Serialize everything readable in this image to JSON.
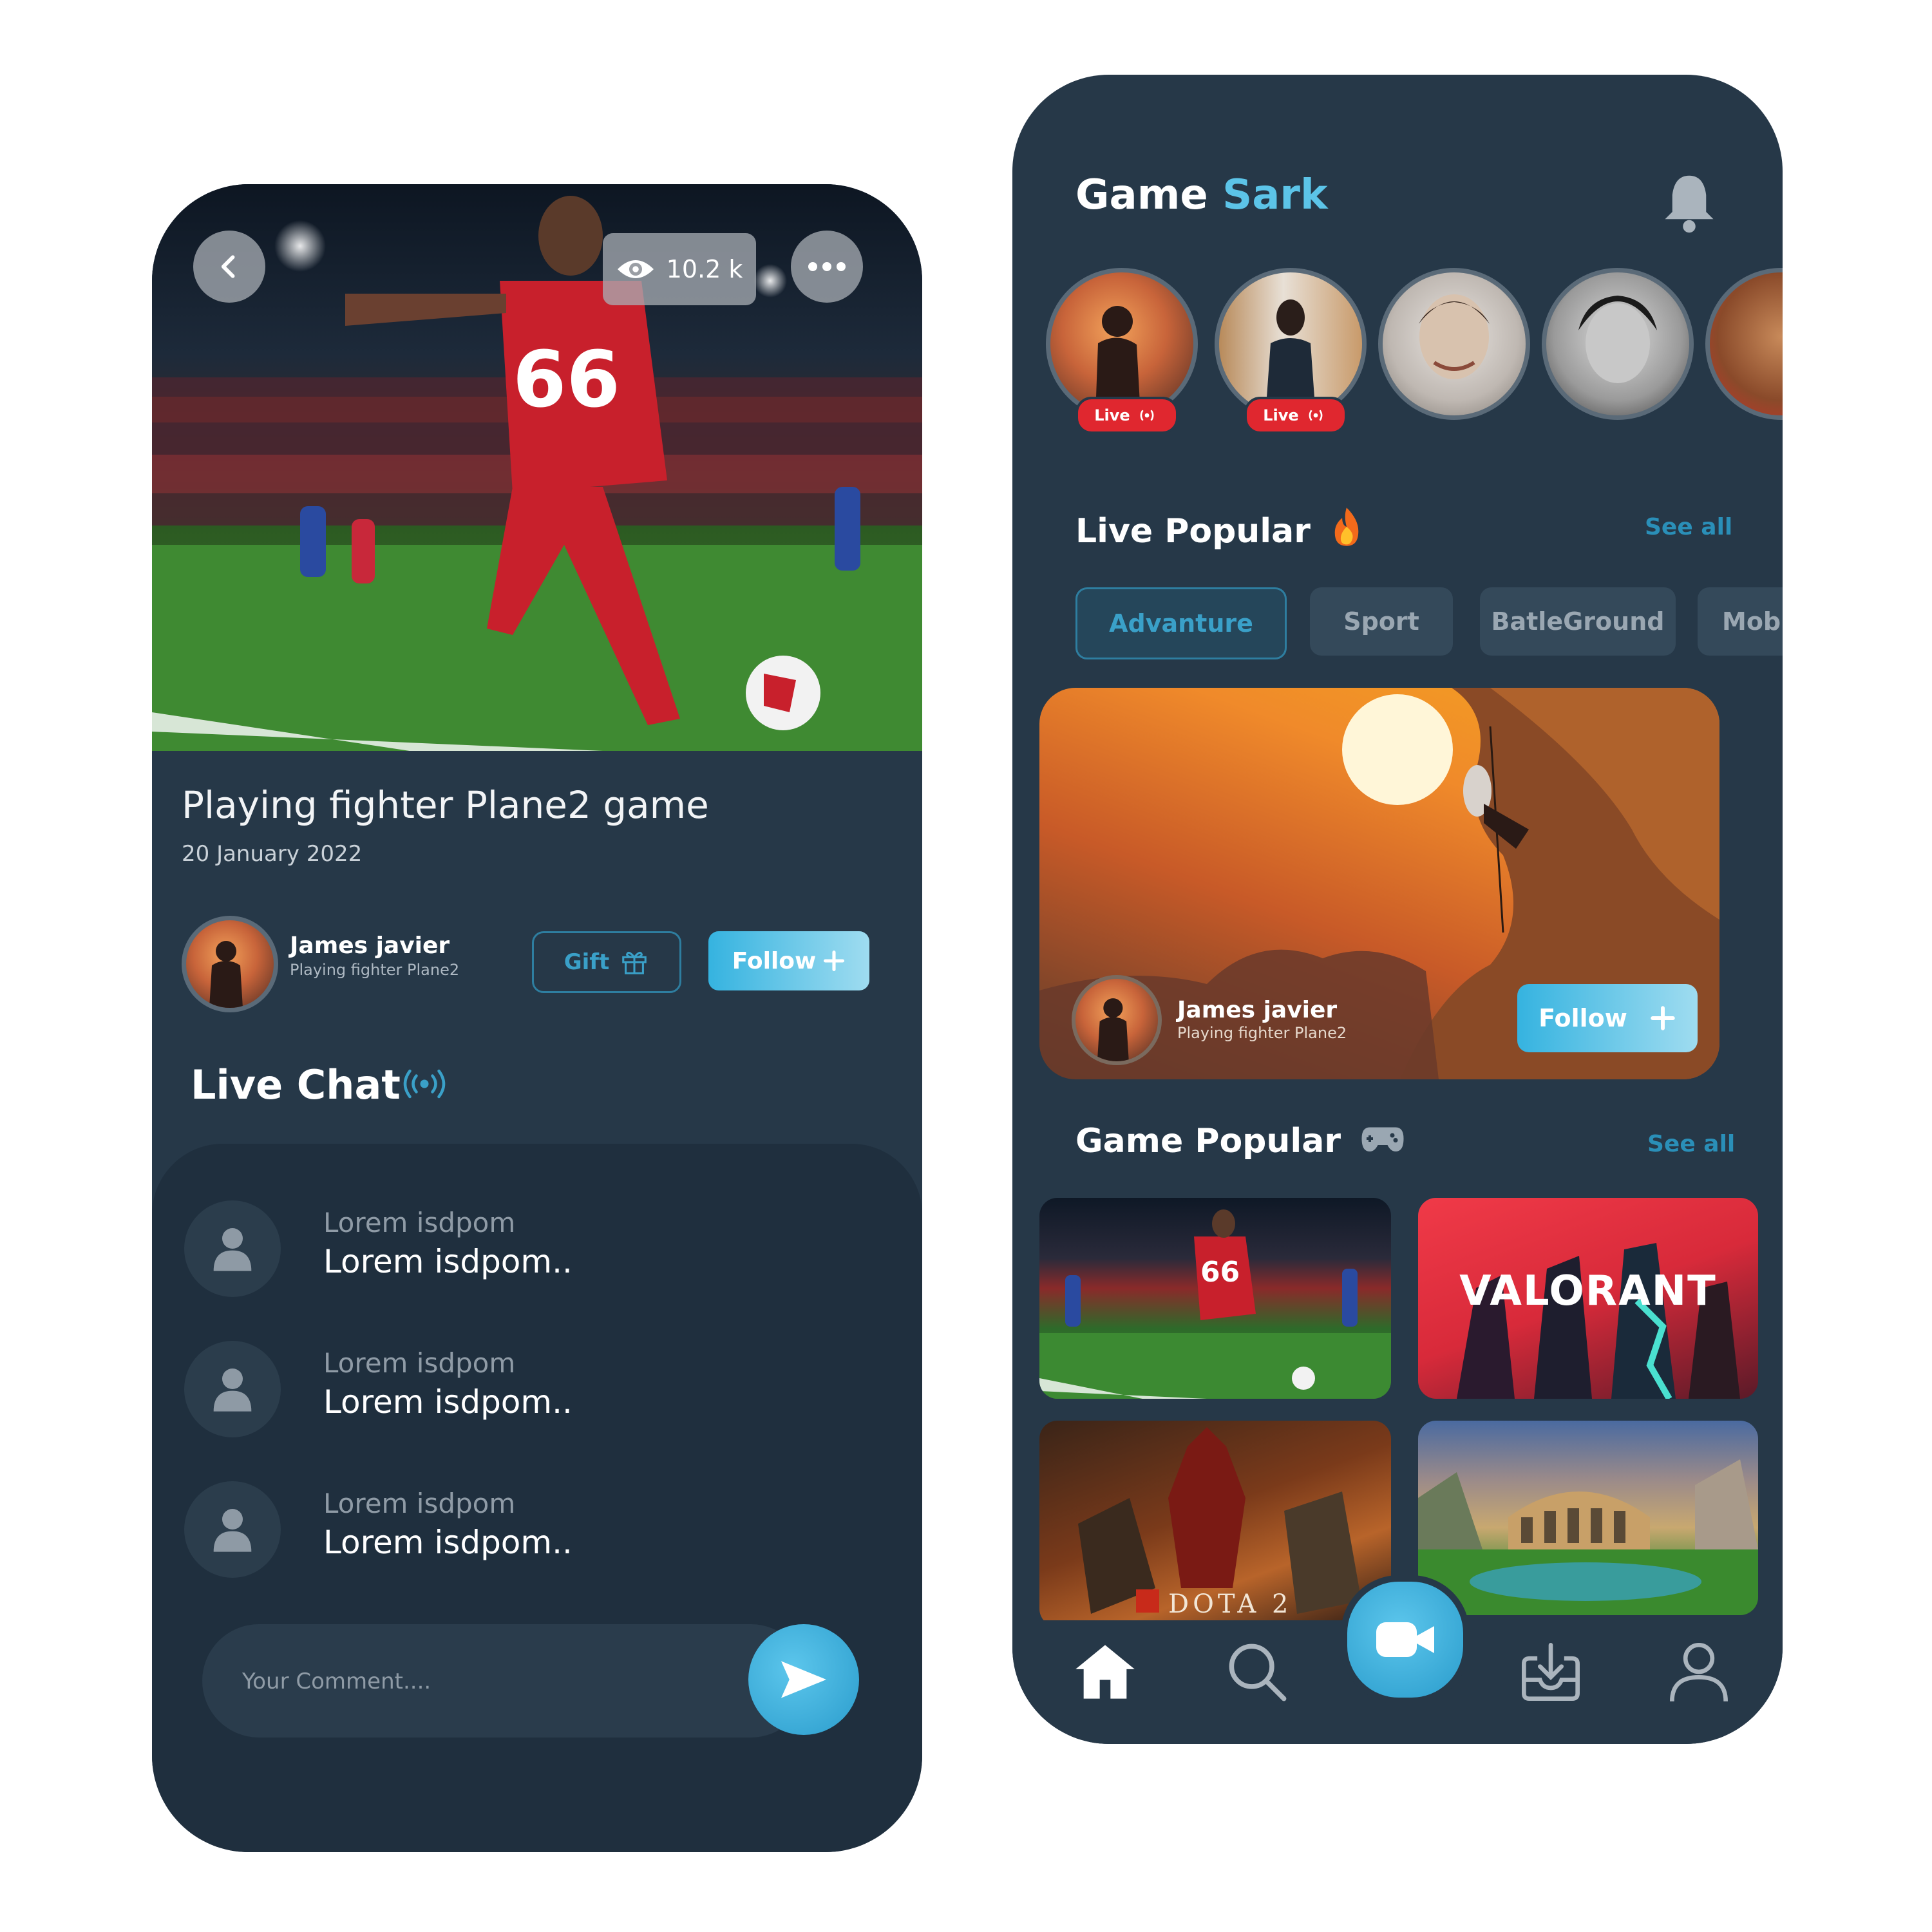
{
  "left_screen": {
    "viewer_count": "10.2 k",
    "stream_title": "Playing fighter Plane2 game",
    "stream_date": "20 January 2022",
    "host": {
      "name": "James javier",
      "subtitle": "Playing fighter Plane2"
    },
    "gift_label": "Gift",
    "follow_label": "Follow",
    "live_chat_title": "Live Chat",
    "chat": [
      {
        "name": "Lorem isdpom",
        "message": "Lorem isdpom.."
      },
      {
        "name": "Lorem isdpom",
        "message": "Lorem isdpom.."
      },
      {
        "name": "Lorem isdpom",
        "message": "Lorem isdpom.."
      }
    ],
    "comment_placeholder": "Your Comment...."
  },
  "right_screen": {
    "app_title_part1": "Game",
    "app_title_part2": "Sark",
    "live_badge": "Live",
    "live_popular_title": "Live Popular",
    "see_all": "See all",
    "categories": [
      "Advanture",
      "Sport",
      "BatleGround",
      "Mobi"
    ],
    "featured": {
      "host_name": "James javier",
      "host_subtitle": "Playing fighter Plane2",
      "follow_label": "Follow"
    },
    "game_popular_title": "Game Popular",
    "games": {
      "valorant": "VALORANT",
      "dota": "DOTA 2"
    }
  },
  "colors": {
    "background": "#263848",
    "accent": "#3aa0c8",
    "live_red": "#e0272f"
  },
  "icons": [
    "back-arrow-icon",
    "eye-icon",
    "more-icon",
    "gift-icon",
    "plus-icon",
    "live-signal-icon",
    "user-icon",
    "send-icon",
    "bell-icon",
    "fire-icon",
    "gamepad-icon",
    "home-icon",
    "search-icon",
    "video-camera-icon",
    "download-icon",
    "profile-icon"
  ]
}
